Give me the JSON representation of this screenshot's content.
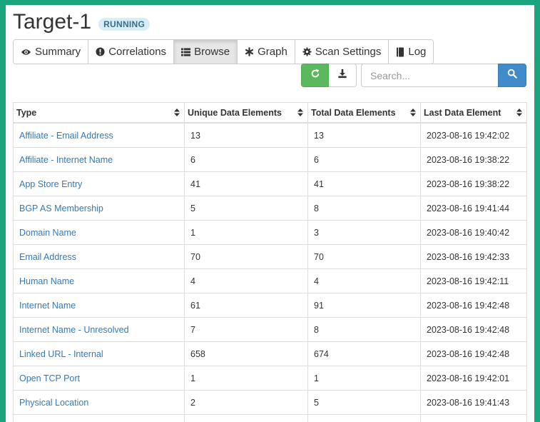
{
  "header": {
    "title": "Target-1",
    "status": "RUNNING"
  },
  "tabs": [
    {
      "label": "Summary",
      "icon": "eye-icon"
    },
    {
      "label": "Correlations",
      "icon": "exclamation-circle-icon"
    },
    {
      "label": "Browse",
      "icon": "list-icon",
      "active": true
    },
    {
      "label": "Graph",
      "icon": "asterisk-icon"
    },
    {
      "label": "Scan Settings",
      "icon": "gear-icon"
    },
    {
      "label": "Log",
      "icon": "book-icon"
    }
  ],
  "toolbar": {
    "refresh_icon": "refresh-icon",
    "download_icon": "download-icon"
  },
  "search": {
    "placeholder": "Search...",
    "value": ""
  },
  "colors": {
    "frame": "#1aa57f",
    "primary": "#428bca",
    "success": "#5cb85c",
    "link": "#337ab7"
  },
  "table": {
    "columns": [
      "Type",
      "Unique Data Elements",
      "Total Data Elements",
      "Last Data Element"
    ],
    "rows": [
      [
        "Affiliate - Email Address",
        "13",
        "13",
        "2023-08-16 19:42:02"
      ],
      [
        "Affiliate - Internet Name",
        "6",
        "6",
        "2023-08-16 19:38:22"
      ],
      [
        "App Store Entry",
        "41",
        "41",
        "2023-08-16 19:38:22"
      ],
      [
        "BGP AS Membership",
        "5",
        "8",
        "2023-08-16 19:41:44"
      ],
      [
        "Domain Name",
        "1",
        "3",
        "2023-08-16 19:40:42"
      ],
      [
        "Email Address",
        "70",
        "70",
        "2023-08-16 19:42:33"
      ],
      [
        "Human Name",
        "4",
        "4",
        "2023-08-16 19:42:11"
      ],
      [
        "Internet Name",
        "61",
        "91",
        "2023-08-16 19:42:48"
      ],
      [
        "Internet Name - Unresolved",
        "7",
        "8",
        "2023-08-16 19:42:48"
      ],
      [
        "Linked URL - Internal",
        "658",
        "674",
        "2023-08-16 19:42:48"
      ],
      [
        "Open TCP Port",
        "1",
        "1",
        "2023-08-16 19:42:01"
      ],
      [
        "Physical Location",
        "2",
        "5",
        "2023-08-16 19:41:43"
      ]
    ]
  }
}
